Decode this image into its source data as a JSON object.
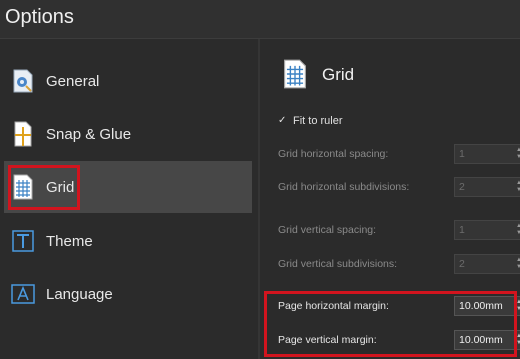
{
  "window": {
    "title": "Options"
  },
  "sidebar": {
    "items": [
      {
        "label": "General",
        "icon": "general-settings-icon"
      },
      {
        "label": "Snap & Glue",
        "icon": "snap-glue-icon"
      },
      {
        "label": "Grid",
        "icon": "grid-icon",
        "selected": true
      },
      {
        "label": "Theme",
        "icon": "theme-icon"
      },
      {
        "label": "Language",
        "icon": "language-icon"
      }
    ]
  },
  "panel": {
    "title": "Grid",
    "fit_to_ruler": {
      "label": "Fit to ruler",
      "checked": true
    },
    "fields": [
      {
        "label": "Grid horizontal spacing:",
        "value": "1",
        "enabled": false
      },
      {
        "label": "Grid horizontal subdivisions:",
        "value": "2",
        "enabled": false
      },
      {
        "label": "Grid vertical spacing:",
        "value": "1",
        "enabled": false
      },
      {
        "label": "Grid vertical subdivisions:",
        "value": "2",
        "enabled": false
      },
      {
        "label": "Page horizontal margin:",
        "value": "10.00mm",
        "enabled": true
      },
      {
        "label": "Page vertical margin:",
        "value": "10.00mm",
        "enabled": true
      }
    ]
  },
  "colors": {
    "highlight": "#d2141e",
    "background": "#2b2b2b",
    "selected_item": "#474747"
  }
}
